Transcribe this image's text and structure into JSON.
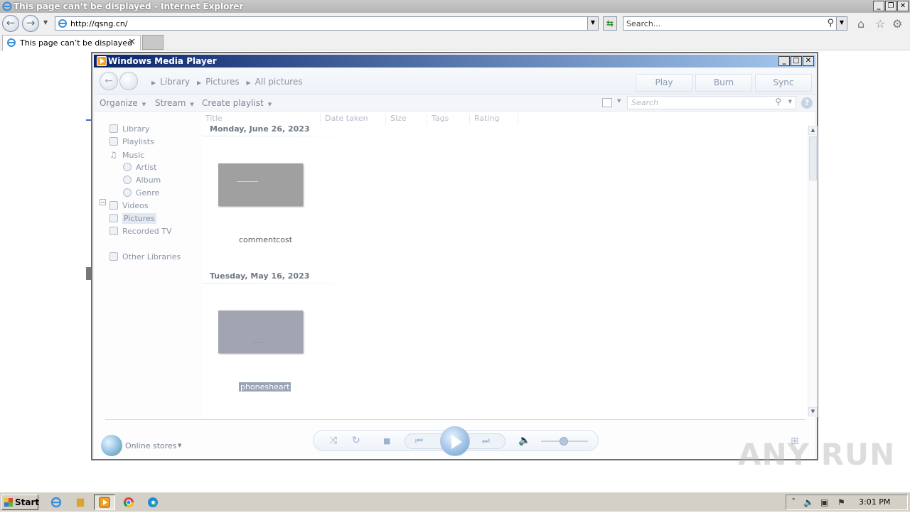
{
  "ie": {
    "window_title": "This page can’t be displayed - Internet Explorer",
    "address": "http://qsng.cn/",
    "search_placeholder": "Search...",
    "tab_title": "This page can’t be displayed"
  },
  "wmp": {
    "window_title": "Windows Media Player",
    "breadcrumb": [
      "Library",
      "Pictures",
      "All pictures"
    ],
    "buttons": {
      "play": "Play",
      "burn": "Burn",
      "sync": "Sync"
    },
    "toolbar": {
      "organize": "Organize",
      "stream": "Stream",
      "create_playlist": "Create playlist"
    },
    "search_placeholder": "Search",
    "columns": [
      "Title",
      "Date taken",
      "Size",
      "Tags",
      "Rating"
    ],
    "nav": {
      "library": "Library",
      "playlists": "Playlists",
      "music": "Music",
      "artist": "Artist",
      "album": "Album",
      "genre": "Genre",
      "videos": "Videos",
      "pictures": "Pictures",
      "recorded_tv": "Recorded TV",
      "other_libraries": "Other Libraries",
      "online_stores": "Online stores"
    },
    "groups": [
      {
        "date": "Monday, June 26, 2023",
        "item": "commentcost",
        "thumb_color": "#a0a0a0",
        "selected": false
      },
      {
        "date": "Tuesday, May 16, 2023",
        "item": "phonesheart",
        "thumb_color": "#a2a5b1",
        "selected": true
      }
    ]
  },
  "watermark": "ANY RUN",
  "taskbar": {
    "start_label": "Start",
    "clock": "3:01 PM"
  }
}
